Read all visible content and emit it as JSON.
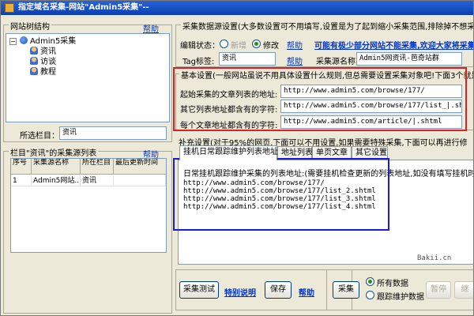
{
  "window": {
    "title": "指定域名采集-网站\"Admin5采集\"--"
  },
  "site_structure": {
    "legend": "网站树结构",
    "help": "帮助",
    "tree": {
      "root": "Admin5采集",
      "children": [
        "资讯",
        "访谈",
        "教程"
      ]
    },
    "selected_label": "所选栏目：",
    "selected_value": "资讯"
  },
  "source_list": {
    "legend": "栏目\"资讯\"的采集源列表",
    "help": "帮助",
    "columns": [
      "序号",
      "采集源名称",
      "所在栏目",
      "最后更新时间"
    ],
    "rows": [
      {
        "index": "1",
        "name": "Admin5网站...",
        "column": "资讯",
        "updated": ""
      }
    ]
  },
  "source_settings": {
    "legend": "采集数据源设置(大多数设置可不用填写,设置是为了起到缩小采集范围,排除掉不想采集的",
    "edit_status_label": "编辑状态：",
    "radio_new": "新增",
    "radio_modify": "修改",
    "help": "帮助",
    "promo_link": "可能有极少部分网站不能采集,欢迎大家将采集",
    "tag_label": "Tag标签:",
    "tag_value": "资讯",
    "tag_help": "帮助",
    "source_name_label": "采集源名称:",
    "source_name_value": "Admin5网资讯-芭奇站群"
  },
  "basic_settings": {
    "legend": "基本设置(一般网站虽说不用具体设置什么规则,但总需要设置采集对象吧!下面3个就是",
    "start_list_label": "起始采集的文章列表的地址:",
    "start_list_value": "http://www.admin5.com/browse/177/",
    "other_list_label": "其它列表地址都含有的字符:",
    "other_list_value": "http://www.admin5.com/browse/177/list_|.shtml",
    "article_label": "每个文章地址都含有的字符:",
    "article_value": "http://www.admin5.com/article/|.shtml"
  },
  "supplement": {
    "legend": "补充设置(对于95%的网页,下面可以不用设置,如果需要特殊采集,下面可以再进行修",
    "tabs": [
      "挂机日常跟踪维护列表地址",
      "地址列表",
      "单页文章",
      "其它设置"
    ],
    "panel_title": "日常挂机跟踪维护采集的列表地址:(需要挂机检查更新的列表地址,如没有填写挂机时会",
    "urls": [
      "http://www.admin5.com/browse/177/",
      "http://www.admin5.com/browse/177/list_2.shtml",
      "http://www.admin5.com/browse/177/list_3.shtml",
      "http://www.admin5.com/browse/177/list_4.shtml"
    ],
    "watermark": "Bakii.cn"
  },
  "actions": {
    "test_button": "采集测试",
    "special_link": "特别说明",
    "save_button": "保存",
    "help": "帮助",
    "collect_button": "采集",
    "radio_all": "所有数据",
    "radio_tracked": "跟踪维护数据",
    "pause_button": "暂停",
    "cut_button": "继"
  }
}
